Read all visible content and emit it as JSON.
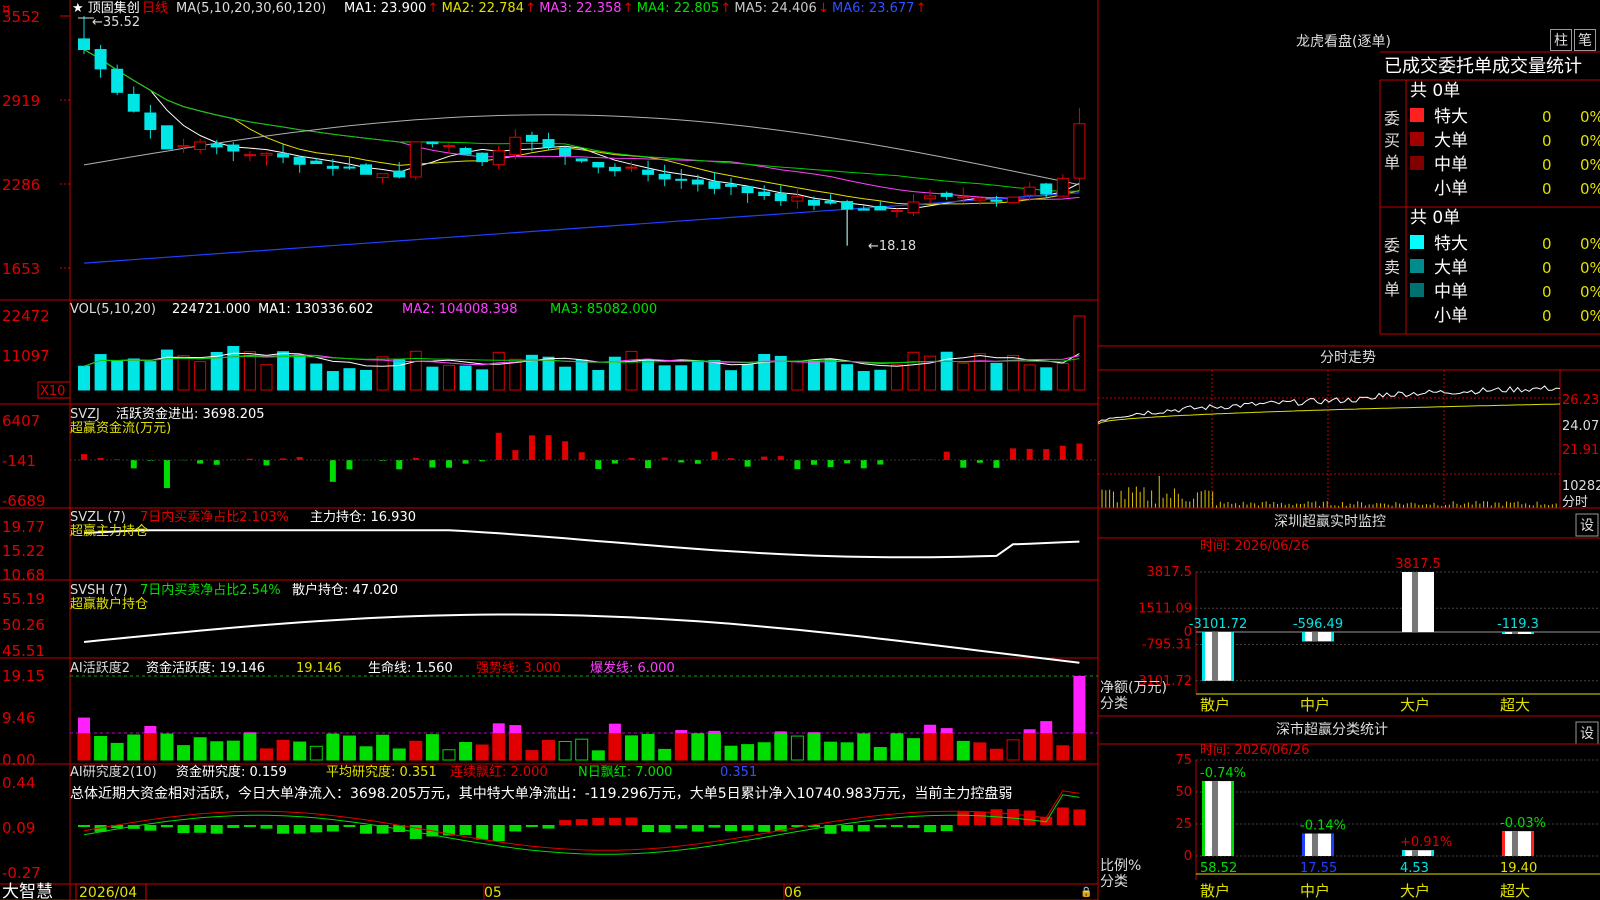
{
  "stock": {
    "name": "★ 顶固集创",
    "period": "日线",
    "ma_label": "MA(5,10,20,30,60,120)",
    "ma": [
      {
        "label": "MA1: 23.900",
        "arrow": "↑",
        "color": "#ffffff"
      },
      {
        "label": "MA2: 22.784",
        "arrow": "↑",
        "color": "#e0e000"
      },
      {
        "label": "MA3: 22.358",
        "arrow": "↑",
        "color": "#ff40ff"
      },
      {
        "label": "MA4: 22.805",
        "arrow": "↑",
        "color": "#00e000"
      },
      {
        "label": "MA5: 24.406",
        "arrow": "↓",
        "color": "#c8c8c8"
      },
      {
        "label": "MA6: 23.677",
        "arrow": "↑",
        "color": "#3050ff"
      }
    ],
    "high_label": "35.52",
    "low_label": "18.18",
    "price_ticks": [
      "3552",
      "2919",
      "2286",
      "1653"
    ]
  },
  "vol": {
    "title": "VOL(5,10,20)",
    "value": "224721.000",
    "ma1": "MA1: 130336.602",
    "ma2": "MA2: 104008.398",
    "ma3": "MA3: 85082.000",
    "ticks": [
      "22472",
      "11097"
    ],
    "unit": "X10"
  },
  "svzj": {
    "title": "SVZJ",
    "label": "活跃资金进出: 3698.205",
    "sub": "超赢资金流(万元)",
    "ticks": [
      "6407",
      "-141",
      "-6689"
    ]
  },
  "svzl": {
    "title": "SVZL (7)",
    "label1": "7日内买卖净占比2.103%",
    "label2": "主力持仓: 16.930",
    "sub": "超赢主力持仓",
    "ticks": [
      "19.77",
      "15.22",
      "10.68"
    ]
  },
  "svsh": {
    "title": "SVSH (7)",
    "label1": "7日内买卖净占比2.54%",
    "label2": "散户持仓: 47.020",
    "sub": "超赢散户持仓",
    "ticks": [
      "55.19",
      "50.26",
      "45.51"
    ]
  },
  "ai1": {
    "title": "AI活跃度2",
    "label": "资金活跃度: 19.146",
    "v2": "19.146",
    "v3": "生命线: 1.560",
    "v4": "强势线: 3.000",
    "v5": "爆发线: 6.000",
    "ticks": [
      "19.15",
      "9.46",
      "0.00"
    ]
  },
  "ai2": {
    "title": "AI研究度2(10)",
    "label": "资金研究度: 0.159",
    "v2": "平均研究度: 0.351",
    "v3": "连续飘红: 2.000",
    "v4": "N日飘红: 7.000",
    "v5": "0.351",
    "ticks": [
      "0.44",
      "0.09",
      "-0.27"
    ],
    "summary": "总体近期大资金相对活跃，今日大单净流入：3698.205万元，其中特大单净流出：-119.296万元，大单5日累计净入10740.983万元，当前主力控盘弱"
  },
  "dates": [
    "2026/04",
    "05",
    "06"
  ],
  "brand": "大智慧",
  "right": {
    "lhb_title": "龙虎看盘(逐单)",
    "btn1": "柱",
    "btn2": "笔",
    "stat_title": "已成交委托单成交量统计",
    "buy_side": "委买单",
    "sell_side": "委卖单",
    "buy_total": "共 0单",
    "sell_total": "共 0单",
    "rows_buy": [
      {
        "name": "特大",
        "n": "0",
        "p": "0%",
        "color": "#ff2020"
      },
      {
        "name": "大单",
        "n": "0",
        "p": "0%",
        "color": "#a00000"
      },
      {
        "name": "中单",
        "n": "0",
        "p": "0%",
        "color": "#800000"
      },
      {
        "name": "小单",
        "n": "0",
        "p": "0%",
        "color": "#000000"
      }
    ],
    "rows_sell": [
      {
        "name": "特大",
        "n": "0",
        "p": "0%",
        "color": "#00ffff"
      },
      {
        "name": "大单",
        "n": "0",
        "p": "0%",
        "color": "#008c8c"
      },
      {
        "name": "中单",
        "n": "0",
        "p": "0%",
        "color": "#007070"
      },
      {
        "name": "小单",
        "n": "0",
        "p": "0%",
        "color": "#000000"
      }
    ],
    "fs_title": "分时走势",
    "fs_ticks": [
      "26.23",
      "24.07",
      "21.91"
    ],
    "fs_vol": "10282",
    "fs_vol2": "分时",
    "monitor_title": "深圳超赢实时监控",
    "set": "设",
    "time_label": "时间: 2026/06/26",
    "mon_ticks": [
      "3817.5",
      "1511.09",
      "0",
      "-795.31",
      "-3101.72"
    ],
    "mon_values": [
      {
        "label": "-3101.72",
        "v": -3101.72
      },
      {
        "label": "-596.49",
        "v": -596.49
      },
      {
        "label": "3817.5",
        "v": 3817.5
      },
      {
        "label": "-119.3",
        "v": -119.3
      }
    ],
    "mon_unit": "净额(万元)",
    "mon_unit2": "分类",
    "cats": [
      "散户",
      "中户",
      "大户",
      "超大"
    ],
    "class_title": "深市超赢分类统计",
    "class_time": "时间: 2026/06/26",
    "class_ticks": [
      "75",
      "50",
      "25",
      "0"
    ],
    "class_values": [
      {
        "top": "-0.74%",
        "bottom": "58.52",
        "v": 58.52
      },
      {
        "top": "-0.14%",
        "bottom": "17.55",
        "v": 17.55
      },
      {
        "top": "+0.91%",
        "bottom": "4.53",
        "v": 4.53
      },
      {
        "top": "-0.03%",
        "bottom": "19.40",
        "v": 19.4
      }
    ],
    "class_unit": "比例%",
    "class_unit2": "分类"
  }
}
